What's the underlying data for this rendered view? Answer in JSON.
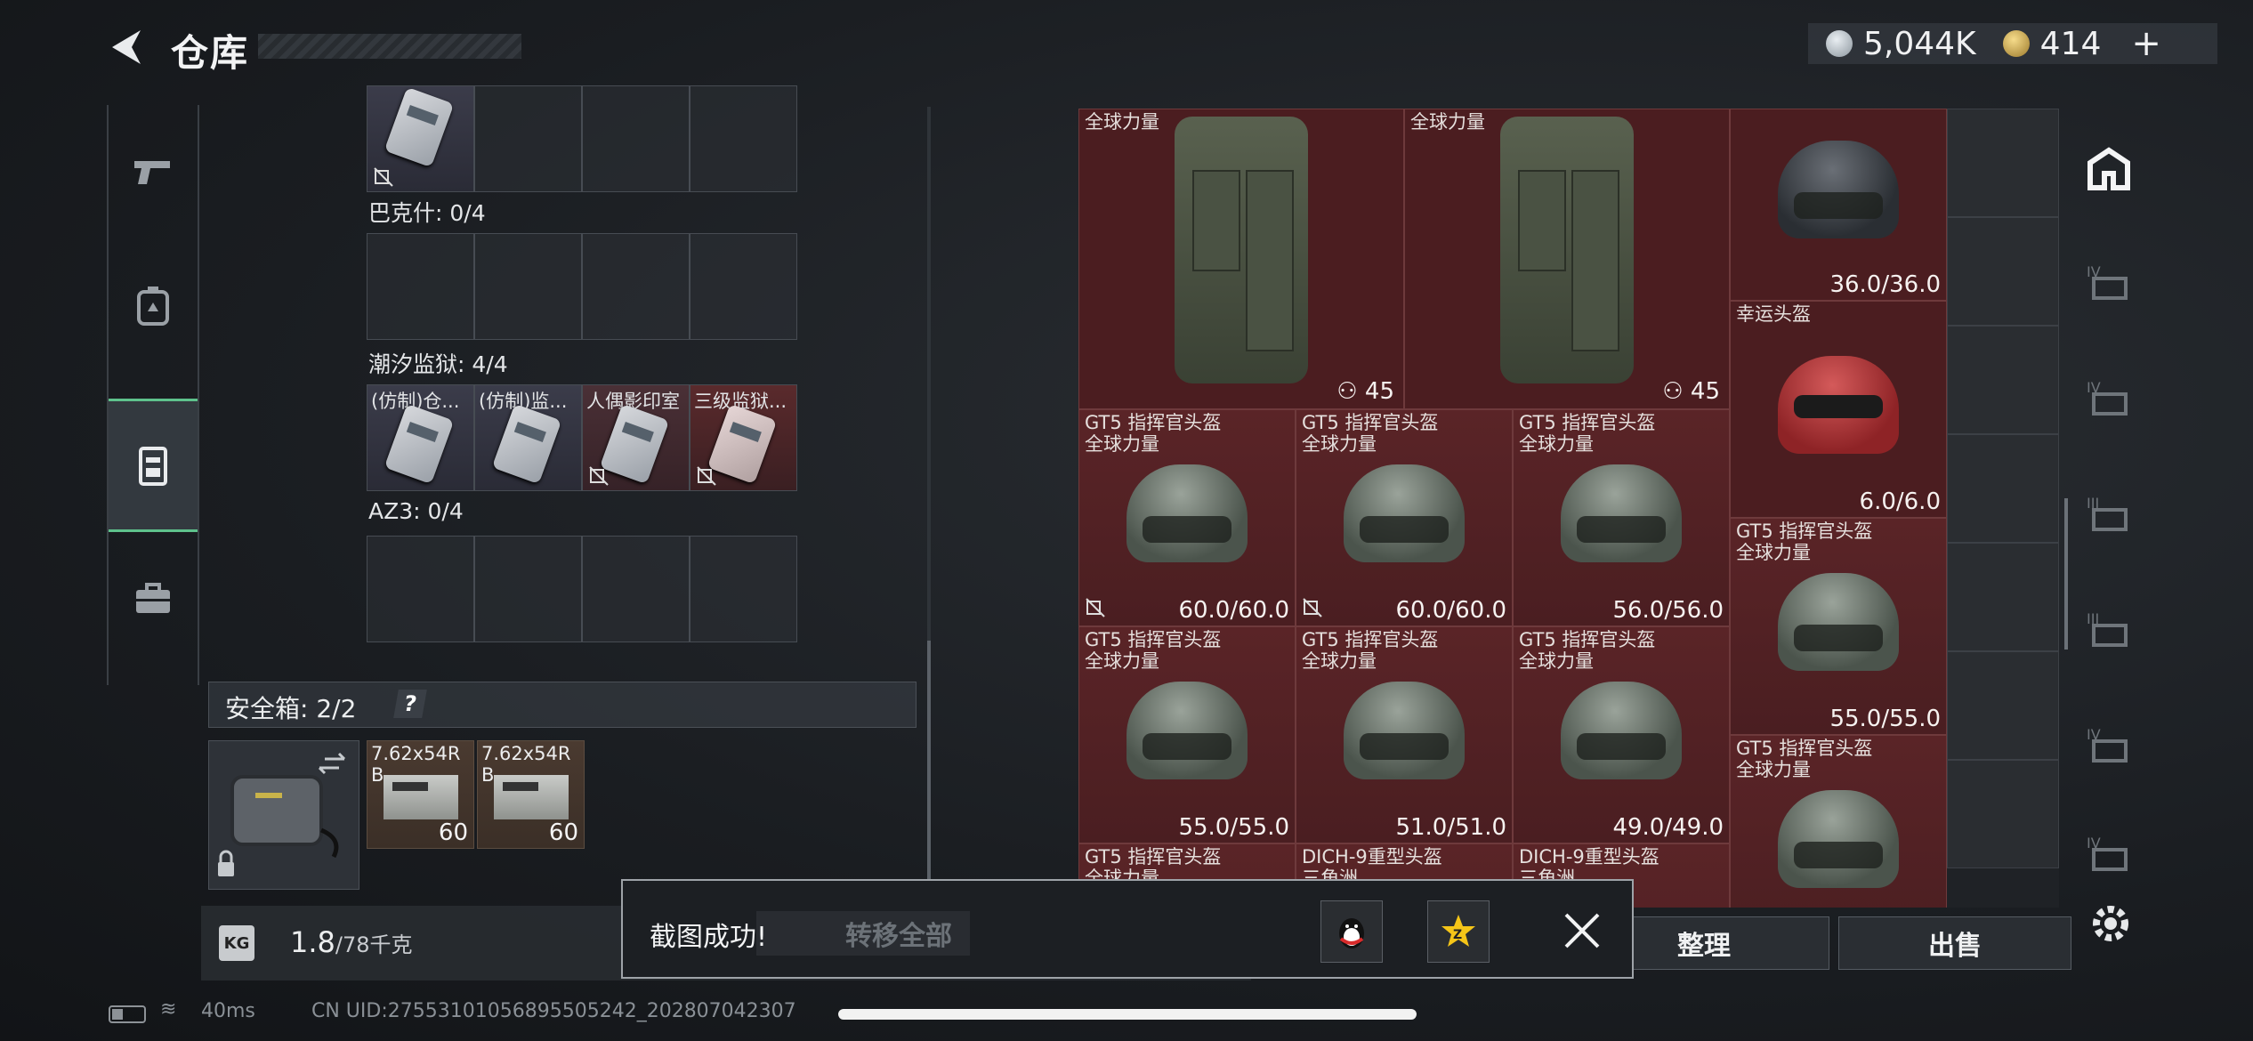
{
  "header": {
    "title": "仓库",
    "silver": "5,044K",
    "gold": "414",
    "plus": "+"
  },
  "left": {
    "groups": [
      {
        "label": "巴克什: 0/4"
      },
      {
        "label": "潮汐监狱: 4/4"
      },
      {
        "label": "AZ3: 0/4"
      }
    ],
    "tidal_items": [
      "(仿制)仓...",
      "(仿制)监...",
      "人偶影印室",
      "三级监狱..."
    ],
    "safe": {
      "label": "安全箱: 2/2",
      "help": "?"
    },
    "ammo": [
      {
        "name": "7.62x54R B",
        "count": "60"
      },
      {
        "name": "7.62x54R B",
        "count": "60"
      }
    ],
    "weight": {
      "value": "1.8",
      "max": "/78千克"
    }
  },
  "grid": {
    "pants": [
      {
        "name": "全球力量",
        "count": "45"
      },
      {
        "name": "全球力量",
        "count": "45"
      }
    ],
    "nvg_helmet": {
      "dur": "36.0/36.0"
    },
    "lucky_helmet": {
      "name": "幸运头盔",
      "dur": "6.0/6.0"
    },
    "cells": [
      {
        "name1": "GT5 指挥官头盔",
        "name2": "全球力量",
        "dur": "60.0/60.0"
      },
      {
        "name1": "GT5 指挥官头盔",
        "name2": "全球力量",
        "dur": "60.0/60.0"
      },
      {
        "name1": "GT5 指挥官头盔",
        "name2": "全球力量",
        "dur": "56.0/56.0"
      },
      {
        "name1": "GT5 指挥官头盔",
        "name2": "全球力量",
        "dur": "55.0/55.0"
      },
      {
        "name1": "GT5 指挥官头盔",
        "name2": "全球力量",
        "dur": "55.0/55.0"
      },
      {
        "name1": "GT5 指挥官头盔",
        "name2": "全球力量",
        "dur": "51.0/51.0"
      },
      {
        "name1": "GT5 指挥官头盔",
        "name2": "全球力量",
        "dur": "49.0/49.0"
      },
      {
        "name1": "GT5 指挥官头盔",
        "name2": "全球力量",
        "dur": ""
      },
      {
        "name1": "GT5 指挥官头盔",
        "name2": "全球力量",
        "dur": ""
      },
      {
        "name1": "DICH-9重型头盔",
        "name2": "三角洲",
        "dur": ""
      },
      {
        "name1": "DICH-9重型头盔",
        "name2": "三角洲",
        "dur": ""
      }
    ]
  },
  "buttons": {
    "transfer_all": "转移全部",
    "sort": "整理",
    "sell": "出售"
  },
  "toast": {
    "text": "截图成功!"
  },
  "footer": {
    "ping": "40ms",
    "uid": "CN UID:27553101056895505242_202807042307"
  },
  "colors": {
    "accent": "#5ec28c",
    "cell_red": "#5a2427"
  }
}
